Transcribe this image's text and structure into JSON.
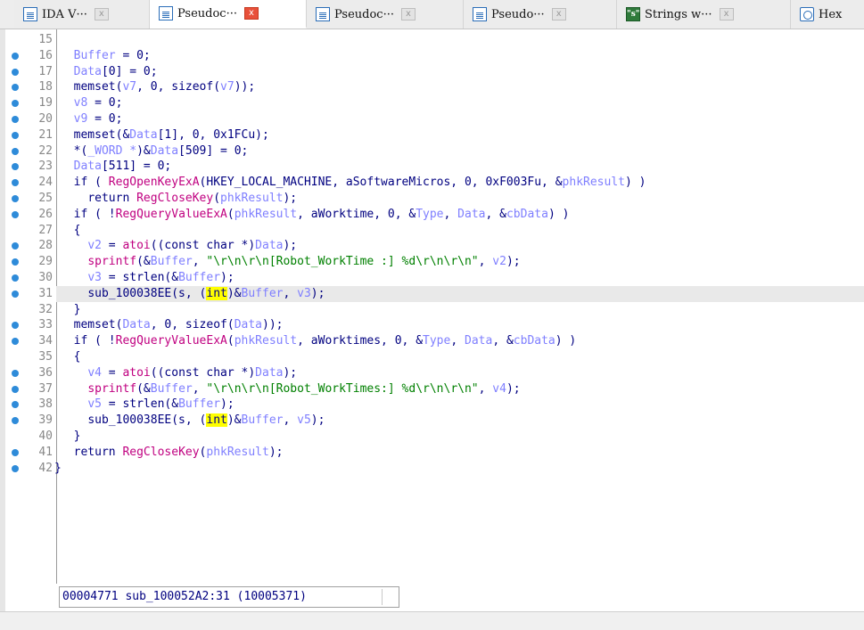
{
  "tabs": [
    {
      "label": "IDA V···",
      "icon": "ida-view-icon",
      "active": false
    },
    {
      "label": "Pseudoc···",
      "icon": "pseudocode-icon",
      "active": true
    },
    {
      "label": "Pseudoc···",
      "icon": "pseudocode-icon",
      "active": false
    },
    {
      "label": "Pseudo···",
      "icon": "pseudocode-icon",
      "active": false
    },
    {
      "label": "Strings w···",
      "icon": "strings-icon",
      "active": false
    },
    {
      "label": "Hex ",
      "icon": "hex-view-icon",
      "active": false
    }
  ],
  "close_glyph": "x",
  "strings_icon_glyph": "\"s\"",
  "gutter": [
    {
      "no": "15",
      "bp": false
    },
    {
      "no": "16",
      "bp": true
    },
    {
      "no": "17",
      "bp": true
    },
    {
      "no": "18",
      "bp": true
    },
    {
      "no": "19",
      "bp": true
    },
    {
      "no": "20",
      "bp": true
    },
    {
      "no": "21",
      "bp": true
    },
    {
      "no": "22",
      "bp": true
    },
    {
      "no": "23",
      "bp": true
    },
    {
      "no": "24",
      "bp": true
    },
    {
      "no": "25",
      "bp": true
    },
    {
      "no": "26",
      "bp": true
    },
    {
      "no": "27",
      "bp": false
    },
    {
      "no": "28",
      "bp": true
    },
    {
      "no": "29",
      "bp": true
    },
    {
      "no": "30",
      "bp": true
    },
    {
      "no": "31",
      "bp": true
    },
    {
      "no": "32",
      "bp": false
    },
    {
      "no": "33",
      "bp": true
    },
    {
      "no": "34",
      "bp": true
    },
    {
      "no": "35",
      "bp": false
    },
    {
      "no": "36",
      "bp": true
    },
    {
      "no": "37",
      "bp": true
    },
    {
      "no": "38",
      "bp": true
    },
    {
      "no": "39",
      "bp": true
    },
    {
      "no": "40",
      "bp": false
    },
    {
      "no": "41",
      "bp": true
    },
    {
      "no": "42",
      "bp": true
    }
  ],
  "code_lines": [
    [],
    [
      [
        "  ",
        ""
      ],
      [
        "Buffer",
        "v"
      ],
      [
        " = 0;",
        "k"
      ]
    ],
    [
      [
        "  ",
        ""
      ],
      [
        "Data",
        "v"
      ],
      [
        "[0] = 0;",
        "k"
      ]
    ],
    [
      [
        "  ",
        ""
      ],
      [
        "memset(",
        "k"
      ],
      [
        "v7",
        "v"
      ],
      [
        ", 0, sizeof(",
        "k"
      ],
      [
        "v7",
        "v"
      ],
      [
        "));",
        "k"
      ]
    ],
    [
      [
        "  ",
        ""
      ],
      [
        "v8",
        "v"
      ],
      [
        " = 0;",
        "k"
      ]
    ],
    [
      [
        "  ",
        ""
      ],
      [
        "v9",
        "v"
      ],
      [
        " = 0;",
        "k"
      ]
    ],
    [
      [
        "  ",
        ""
      ],
      [
        "memset(&",
        "k"
      ],
      [
        "Data",
        "v"
      ],
      [
        "[1], 0, 0x1FCu);",
        "k"
      ]
    ],
    [
      [
        "  ",
        ""
      ],
      [
        "*(",
        "k"
      ],
      [
        "_WORD *",
        "v"
      ],
      [
        ")&",
        "k"
      ],
      [
        "Data",
        "v"
      ],
      [
        "[509] = 0;",
        "k"
      ]
    ],
    [
      [
        "  ",
        ""
      ],
      [
        "Data",
        "v"
      ],
      [
        "[511] = 0;",
        "k"
      ]
    ],
    [
      [
        "  ",
        ""
      ],
      [
        "if ( ",
        "k"
      ],
      [
        "RegOpenKeyExA",
        "f"
      ],
      [
        "(HKEY_LOCAL_MACHINE, aSoftwareMicros, 0, 0xF003Fu, &",
        "k"
      ],
      [
        "phkResult",
        "v"
      ],
      [
        ") )",
        "k"
      ]
    ],
    [
      [
        "    ",
        ""
      ],
      [
        "return ",
        "k"
      ],
      [
        "RegCloseKey",
        "f"
      ],
      [
        "(",
        "k"
      ],
      [
        "phkResult",
        "v"
      ],
      [
        ");",
        "k"
      ]
    ],
    [
      [
        "  ",
        ""
      ],
      [
        "if ( !",
        "k"
      ],
      [
        "RegQueryValueExA",
        "f"
      ],
      [
        "(",
        "k"
      ],
      [
        "phkResult",
        "v"
      ],
      [
        ", aWorktime, 0, &",
        "k"
      ],
      [
        "Type",
        "v"
      ],
      [
        ", ",
        "k"
      ],
      [
        "Data",
        "v"
      ],
      [
        ", &",
        "k"
      ],
      [
        "cbData",
        "v"
      ],
      [
        ") )",
        "k"
      ]
    ],
    [
      [
        "  ",
        ""
      ],
      [
        "{",
        "k"
      ]
    ],
    [
      [
        "    ",
        ""
      ],
      [
        "v2",
        "v"
      ],
      [
        " = ",
        "k"
      ],
      [
        "atoi",
        "f"
      ],
      [
        "((const char *)",
        "k"
      ],
      [
        "Data",
        "v"
      ],
      [
        ");",
        "k"
      ]
    ],
    [
      [
        "    ",
        ""
      ],
      [
        "sprintf",
        "f"
      ],
      [
        "(&",
        "k"
      ],
      [
        "Buffer",
        "v"
      ],
      [
        ", ",
        "k"
      ],
      [
        "\"\\r\\n\\r\\n[Robot_WorkTime :] %d\\r\\n\\r\\n\"",
        "s"
      ],
      [
        ", ",
        "k"
      ],
      [
        "v2",
        "v"
      ],
      [
        ");",
        "k"
      ]
    ],
    [
      [
        "    ",
        ""
      ],
      [
        "v3",
        "v"
      ],
      [
        " = strlen(&",
        "k"
      ],
      [
        "Buffer",
        "v"
      ],
      [
        ");",
        "k"
      ]
    ],
    [
      [
        "    ",
        ""
      ],
      [
        "sub_100038EE(s, (",
        "k"
      ],
      [
        "int",
        "hl-int"
      ],
      [
        ")&",
        "k"
      ],
      [
        "Buffer",
        "v"
      ],
      [
        ", ",
        "k"
      ],
      [
        "v3",
        "v"
      ],
      [
        ");",
        "k"
      ]
    ],
    [
      [
        "  ",
        ""
      ],
      [
        "}",
        "k"
      ]
    ],
    [
      [
        "  ",
        ""
      ],
      [
        "memset(",
        "k"
      ],
      [
        "Data",
        "v"
      ],
      [
        ", 0, sizeof(",
        "k"
      ],
      [
        "Data",
        "v"
      ],
      [
        "));",
        "k"
      ]
    ],
    [
      [
        "  ",
        ""
      ],
      [
        "if ( !",
        "k"
      ],
      [
        "RegQueryValueExA",
        "f"
      ],
      [
        "(",
        "k"
      ],
      [
        "phkResult",
        "v"
      ],
      [
        ", aWorktimes, 0, &",
        "k"
      ],
      [
        "Type",
        "v"
      ],
      [
        ", ",
        "k"
      ],
      [
        "Data",
        "v"
      ],
      [
        ", &",
        "k"
      ],
      [
        "cbData",
        "v"
      ],
      [
        ") )",
        "k"
      ]
    ],
    [
      [
        "  ",
        ""
      ],
      [
        "{",
        "k"
      ]
    ],
    [
      [
        "    ",
        ""
      ],
      [
        "v4",
        "v"
      ],
      [
        " = ",
        "k"
      ],
      [
        "atoi",
        "f"
      ],
      [
        "((const char *)",
        "k"
      ],
      [
        "Data",
        "v"
      ],
      [
        ");",
        "k"
      ]
    ],
    [
      [
        "    ",
        ""
      ],
      [
        "sprintf",
        "f"
      ],
      [
        "(&",
        "k"
      ],
      [
        "Buffer",
        "v"
      ],
      [
        ", ",
        "k"
      ],
      [
        "\"\\r\\n\\r\\n[Robot_WorkTimes:] %d\\r\\n\\r\\n\"",
        "s"
      ],
      [
        ", ",
        "k"
      ],
      [
        "v4",
        "v"
      ],
      [
        ");",
        "k"
      ]
    ],
    [
      [
        "    ",
        ""
      ],
      [
        "v5",
        "v"
      ],
      [
        " = strlen(&",
        "k"
      ],
      [
        "Buffer",
        "v"
      ],
      [
        ");",
        "k"
      ]
    ],
    [
      [
        "    ",
        ""
      ],
      [
        "sub_100038EE(s, (",
        "k"
      ],
      [
        "int",
        "hl-int"
      ],
      [
        ")&",
        "k"
      ],
      [
        "Buffer",
        "v"
      ],
      [
        ", ",
        "k"
      ],
      [
        "v5",
        "v"
      ],
      [
        ");",
        "k"
      ]
    ],
    [
      [
        "  ",
        ""
      ],
      [
        "}",
        "k"
      ]
    ],
    [
      [
        "  ",
        ""
      ],
      [
        "return ",
        "k"
      ],
      [
        "RegCloseKey",
        "f"
      ],
      [
        "(",
        "k"
      ],
      [
        "phkResult",
        "v"
      ],
      [
        ");",
        "k"
      ]
    ],
    [
      [
        "",
        ""
      ],
      [
        "}",
        "k"
      ]
    ]
  ],
  "highlighted_line": 31,
  "status": {
    "text": "00004771 sub_100052A2:31 (10005371)"
  },
  "colors": {
    "breakpoint": "#2e8bd9",
    "close_active": "#e8503a",
    "string": "#008000",
    "function": "#c00080",
    "variable": "#7f7fff",
    "keyword": "#000080"
  }
}
